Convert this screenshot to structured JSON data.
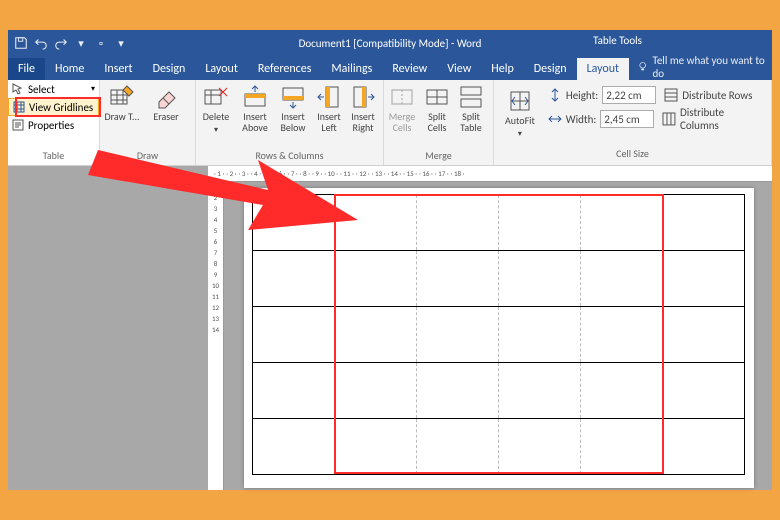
{
  "titlebar": {
    "title": "Document1 [Compatibility Mode] - Word",
    "context_tab_group": "Table Tools"
  },
  "tabs": {
    "file": "File",
    "home": "Home",
    "insert": "Insert",
    "design": "Design",
    "layout": "Layout",
    "references": "References",
    "mailings": "Mailings",
    "review": "Review",
    "view": "View",
    "help": "Help",
    "ctx_design": "Design",
    "ctx_layout": "Layout",
    "tellme": "Tell me what you want to do"
  },
  "ribbon": {
    "table_group": {
      "label": "Table",
      "select": "Select",
      "view_gridlines": "View Gridlines",
      "properties": "Properties"
    },
    "draw_group": {
      "label": "Draw",
      "draw_table": "Draw T...",
      "eraser": "Eraser"
    },
    "rowscols_group": {
      "label": "Rows & Columns",
      "delete": "Delete",
      "insert_above": "Insert Above",
      "insert_below": "Insert Below",
      "insert_left": "Insert Left",
      "insert_right": "Insert Right"
    },
    "merge_group": {
      "label": "Merge",
      "merge_cells": "Merge Cells",
      "split_cells": "Split Cells",
      "split_table": "Split Table"
    },
    "cellsize_group": {
      "label": "Cell Size",
      "autofit": "AutoFit",
      "height_label": "Height:",
      "height_value": "2,22 cm",
      "width_label": "Width:",
      "width_value": "2,45 cm",
      "dist_rows": "Distribute Rows",
      "dist_cols": "Distribute Columns"
    }
  },
  "table": {
    "rows": 5,
    "cols": 6
  },
  "highlight": {
    "target": "view-gridlines",
    "color": "#ff2a2a"
  }
}
